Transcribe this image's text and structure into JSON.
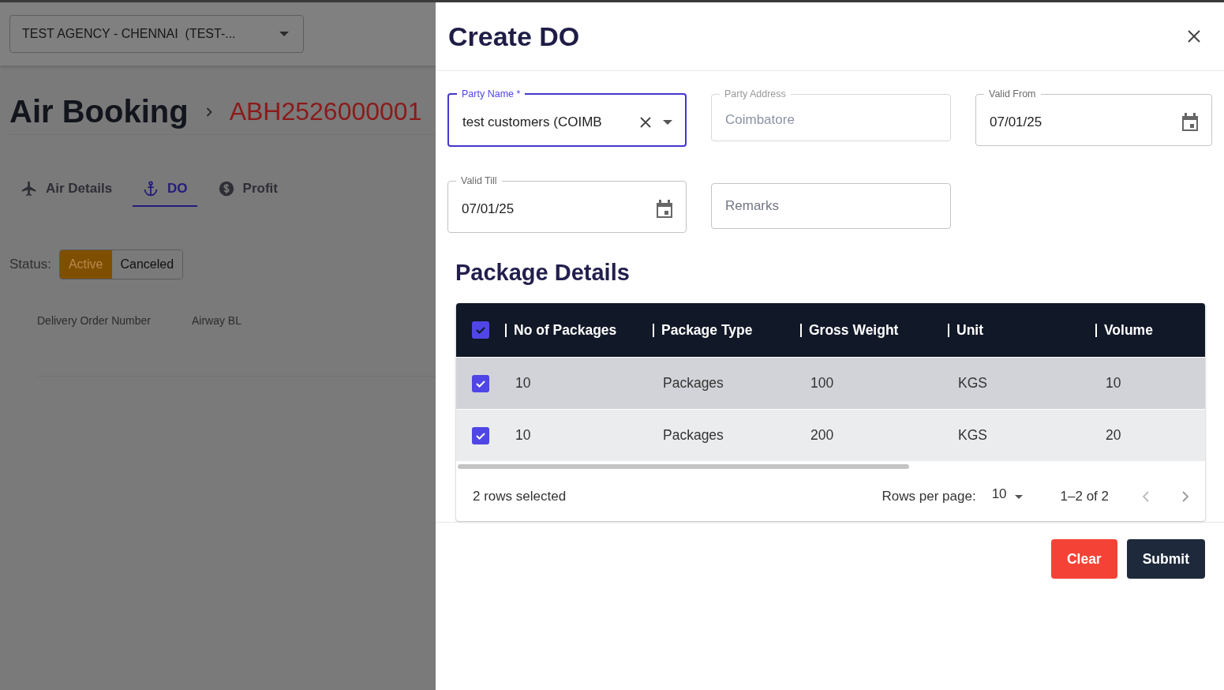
{
  "agency_select": {
    "value": "TEST AGENCY - CHENNAI  (TEST-..."
  },
  "page": {
    "title": "Air Booking",
    "booking_number": "ABH2526000001"
  },
  "tabs": [
    {
      "label": "Air Details",
      "selected": false
    },
    {
      "label": "DO",
      "selected": true
    },
    {
      "label": "Profit",
      "selected": false
    }
  ],
  "status_filter": {
    "label": "Status:",
    "options": [
      {
        "label": "Active",
        "selected": true
      },
      {
        "label": "Canceled",
        "selected": false
      }
    ]
  },
  "list_columns": [
    "Delivery Order Number",
    "Airway BL"
  ],
  "drawer": {
    "title": "Create DO",
    "fields": [
      {
        "kind": "select",
        "label": "Party Name *",
        "value": "test customers (COIMB",
        "focused": true,
        "disabled": false
      },
      {
        "kind": "text",
        "label": "Party Address",
        "value": "Coimbatore",
        "focused": false,
        "disabled": true
      },
      {
        "kind": "date",
        "label": "Valid From",
        "value": "07/01/25",
        "focused": false,
        "disabled": false
      },
      {
        "kind": "date",
        "label": "Valid Till",
        "value": "07/01/25",
        "focused": false,
        "disabled": false
      },
      {
        "kind": "text",
        "placeholder": "Remarks",
        "focused": false,
        "disabled": false
      }
    ],
    "package_details": {
      "title": "Package Details",
      "all_selected": true,
      "columns": [
        "No of Packages",
        "Package Type",
        "Gross Weight",
        "Unit",
        "Volume"
      ],
      "rows": [
        {
          "selected": true,
          "hovered": true,
          "cells": [
            "10",
            "Packages",
            "100",
            "KGS",
            "10"
          ]
        },
        {
          "selected": true,
          "hovered": false,
          "cells": [
            "10",
            "Packages",
            "200",
            "KGS",
            "20"
          ]
        }
      ],
      "footer": {
        "selection_text": "2 rows selected",
        "rows_per_page_label": "Rows per page:",
        "rows_per_page": "10",
        "range": "1–2 of 2"
      }
    },
    "buttons": [
      {
        "kind": "clear",
        "label": "Clear"
      },
      {
        "kind": "submit",
        "label": "Submit"
      }
    ]
  }
}
